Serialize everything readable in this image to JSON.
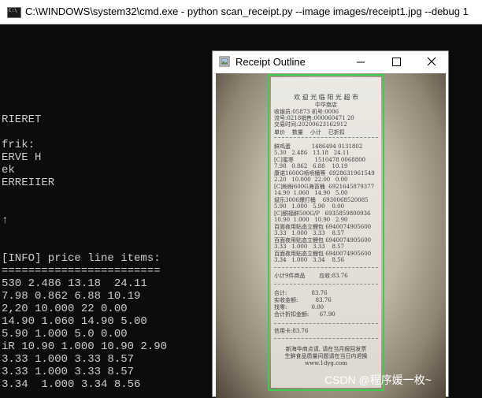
{
  "cmd": {
    "title": "C:\\WINDOWS\\system32\\cmd.exe - python  scan_receipt.py --image images/receipt1.jpg --debug 1",
    "icon": "cmd-icon",
    "icon_text": "C:\\",
    "lines": [
      "RIERET",
      "frik:",
      "ERVE H",
      "ek",
      "ERREIIER",
      "↑",
      "[INFO] price line items:",
      "========================",
      "530 2.486 13.18  24.11",
      "7.98 0.862 6.88 10.19",
      "2,20 10.000 22 0.00",
      "14.90 1.060 14.90 5.00",
      "5.90 1.000 5.0 0.00",
      "iR 10.90 1.000 10.90 2.90",
      "3.33 1.000 3.33 8.57",
      "3.33 1.000 3.33 8.57",
      "3.34  1.000 3.34 8.56"
    ]
  },
  "window": {
    "title": "Receipt Outline",
    "icon": "image-viewer-icon",
    "buttons": {
      "minimize": "minimize-icon",
      "maximize": "maximize-icon",
      "close": "close-icon"
    }
  },
  "receipt": {
    "store_name": "欢 迎 光 临 阳 光 超 市",
    "branch": "中华南店",
    "meta": [
      "收银员:05873 机号:0006",
      "流号:0218销售:000060471 20",
      "交易时间:20200623162912"
    ],
    "header": "单价    数量    小计    已折扣",
    "items": [
      "鲜鸡蛋            1486494 0131802",
      "5.30   2.486   13.18   24.11",
      "[C]蜜枣            1510478 0068800",
      "7.98   0.862   6.88    10.19",
      "康诺1600G喷喷桶等  6928631961549",
      "2.20   10.000  22.00   0.00",
      "[C]盼盼600G海苔桶  6921645879377",
      "14.90  1.060   14.90   5.00",
      "斌乐3006爆打桶    6930068520085",
      "5.90   1.000   5.90    0.00",
      "[C]酮福鲜500G/P   6935859800936",
      "10.90  1.000   10.90   2.90",
      "百面夜用贴态立鲤包 6940074905600",
      "3.33   1.000   3.33    8.57",
      "百面夜用贴态立鲤包 6940074905600",
      "3.33   1.000   3.33    8.57",
      "百面夜用贴态立鲤包 6940074905600",
      "3.34   1.000   3.34    8.56"
    ],
    "count_line": "小计9件商品        应收:83.76",
    "totals": [
      "合计:              83.76",
      "实收金额:          83.76",
      "找零:              0.00",
      "合计折扣金额:      67.90"
    ],
    "card_line": "信用卡:83.76",
    "footer": [
      "新海华商点请, 请在当月报回发票",
      "生鲜食品质量问题请在当日内退换",
      "www.1dyg.com"
    ]
  },
  "watermark": "CSDN @程序媛一枚~"
}
